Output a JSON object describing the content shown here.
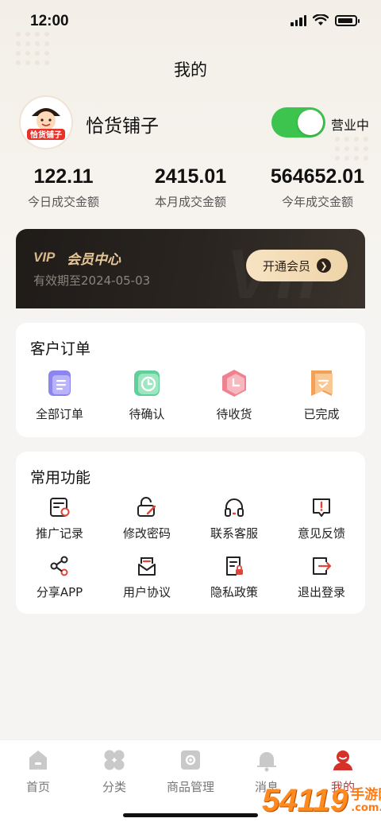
{
  "status": {
    "time": "12:00"
  },
  "page": {
    "title": "我的"
  },
  "shop": {
    "name": "恰货铺子",
    "open_label": "营业中",
    "open": true,
    "avatar_text": "恰货铺子"
  },
  "stats": [
    {
      "value": "122.11",
      "label": "今日成交金额"
    },
    {
      "value": "2415.01",
      "label": "本月成交金额"
    },
    {
      "value": "564652.01",
      "label": "今年成交金额"
    }
  ],
  "vip": {
    "badge": "VIP",
    "title": "会员中心",
    "expiry": "有效期至2024-05-03",
    "button": "开通会员",
    "watermark": "VIP"
  },
  "orders": {
    "title": "客户订单",
    "items": [
      {
        "label": "全部订单",
        "icon": "all-orders-icon"
      },
      {
        "label": "待确认",
        "icon": "clock-icon"
      },
      {
        "label": "待收货",
        "icon": "pending-receipt-icon"
      },
      {
        "label": "已完成",
        "icon": "completed-icon"
      }
    ]
  },
  "functions": {
    "title": "常用功能",
    "items": [
      {
        "label": "推广记录",
        "icon": "promotion-record-icon"
      },
      {
        "label": "修改密码",
        "icon": "lock-edit-icon"
      },
      {
        "label": "联系客服",
        "icon": "headset-icon"
      },
      {
        "label": "意见反馈",
        "icon": "feedback-icon"
      },
      {
        "label": "分享APP",
        "icon": "share-icon"
      },
      {
        "label": "用户协议",
        "icon": "agreement-icon"
      },
      {
        "label": "隐私政策",
        "icon": "privacy-icon"
      },
      {
        "label": "退出登录",
        "icon": "logout-icon"
      }
    ]
  },
  "tabbar": {
    "items": [
      {
        "label": "首页",
        "icon": "home-icon"
      },
      {
        "label": "分类",
        "icon": "category-icon"
      },
      {
        "label": "商品管理",
        "icon": "goods-manage-icon"
      },
      {
        "label": "消息",
        "icon": "bell-icon"
      },
      {
        "label": "我的",
        "icon": "profile-icon",
        "active": true
      }
    ]
  },
  "watermark": {
    "number": "54119",
    "text1": "手游网",
    "text2": ".com.cn"
  },
  "colors": {
    "accent": "#d4312a",
    "toggle_on": "#3dc44e",
    "vip_gold": "#e8c89a"
  }
}
